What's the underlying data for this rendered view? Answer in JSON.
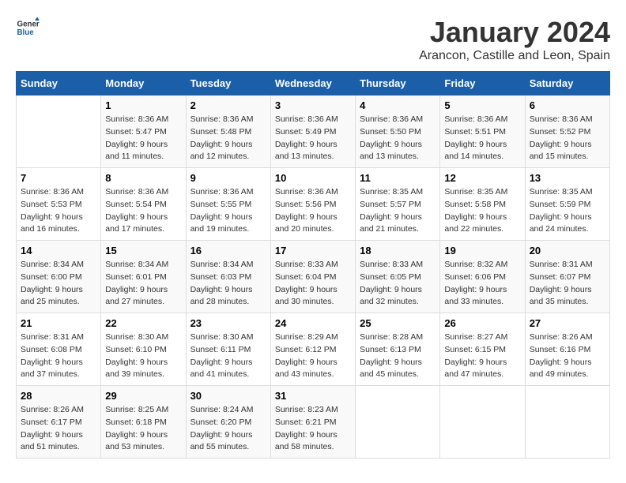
{
  "logo": {
    "text_general": "General",
    "text_blue": "Blue"
  },
  "title": "January 2024",
  "subtitle": "Arancon, Castille and Leon, Spain",
  "header": {
    "days": [
      "Sunday",
      "Monday",
      "Tuesday",
      "Wednesday",
      "Thursday",
      "Friday",
      "Saturday"
    ]
  },
  "weeks": [
    [
      {
        "num": "",
        "info": ""
      },
      {
        "num": "1",
        "info": "Sunrise: 8:36 AM\nSunset: 5:47 PM\nDaylight: 9 hours\nand 11 minutes."
      },
      {
        "num": "2",
        "info": "Sunrise: 8:36 AM\nSunset: 5:48 PM\nDaylight: 9 hours\nand 12 minutes."
      },
      {
        "num": "3",
        "info": "Sunrise: 8:36 AM\nSunset: 5:49 PM\nDaylight: 9 hours\nand 13 minutes."
      },
      {
        "num": "4",
        "info": "Sunrise: 8:36 AM\nSunset: 5:50 PM\nDaylight: 9 hours\nand 13 minutes."
      },
      {
        "num": "5",
        "info": "Sunrise: 8:36 AM\nSunset: 5:51 PM\nDaylight: 9 hours\nand 14 minutes."
      },
      {
        "num": "6",
        "info": "Sunrise: 8:36 AM\nSunset: 5:52 PM\nDaylight: 9 hours\nand 15 minutes."
      }
    ],
    [
      {
        "num": "7",
        "info": "Sunrise: 8:36 AM\nSunset: 5:53 PM\nDaylight: 9 hours\nand 16 minutes."
      },
      {
        "num": "8",
        "info": "Sunrise: 8:36 AM\nSunset: 5:54 PM\nDaylight: 9 hours\nand 17 minutes."
      },
      {
        "num": "9",
        "info": "Sunrise: 8:36 AM\nSunset: 5:55 PM\nDaylight: 9 hours\nand 19 minutes."
      },
      {
        "num": "10",
        "info": "Sunrise: 8:36 AM\nSunset: 5:56 PM\nDaylight: 9 hours\nand 20 minutes."
      },
      {
        "num": "11",
        "info": "Sunrise: 8:35 AM\nSunset: 5:57 PM\nDaylight: 9 hours\nand 21 minutes."
      },
      {
        "num": "12",
        "info": "Sunrise: 8:35 AM\nSunset: 5:58 PM\nDaylight: 9 hours\nand 22 minutes."
      },
      {
        "num": "13",
        "info": "Sunrise: 8:35 AM\nSunset: 5:59 PM\nDaylight: 9 hours\nand 24 minutes."
      }
    ],
    [
      {
        "num": "14",
        "info": "Sunrise: 8:34 AM\nSunset: 6:00 PM\nDaylight: 9 hours\nand 25 minutes."
      },
      {
        "num": "15",
        "info": "Sunrise: 8:34 AM\nSunset: 6:01 PM\nDaylight: 9 hours\nand 27 minutes."
      },
      {
        "num": "16",
        "info": "Sunrise: 8:34 AM\nSunset: 6:03 PM\nDaylight: 9 hours\nand 28 minutes."
      },
      {
        "num": "17",
        "info": "Sunrise: 8:33 AM\nSunset: 6:04 PM\nDaylight: 9 hours\nand 30 minutes."
      },
      {
        "num": "18",
        "info": "Sunrise: 8:33 AM\nSunset: 6:05 PM\nDaylight: 9 hours\nand 32 minutes."
      },
      {
        "num": "19",
        "info": "Sunrise: 8:32 AM\nSunset: 6:06 PM\nDaylight: 9 hours\nand 33 minutes."
      },
      {
        "num": "20",
        "info": "Sunrise: 8:31 AM\nSunset: 6:07 PM\nDaylight: 9 hours\nand 35 minutes."
      }
    ],
    [
      {
        "num": "21",
        "info": "Sunrise: 8:31 AM\nSunset: 6:08 PM\nDaylight: 9 hours\nand 37 minutes."
      },
      {
        "num": "22",
        "info": "Sunrise: 8:30 AM\nSunset: 6:10 PM\nDaylight: 9 hours\nand 39 minutes."
      },
      {
        "num": "23",
        "info": "Sunrise: 8:30 AM\nSunset: 6:11 PM\nDaylight: 9 hours\nand 41 minutes."
      },
      {
        "num": "24",
        "info": "Sunrise: 8:29 AM\nSunset: 6:12 PM\nDaylight: 9 hours\nand 43 minutes."
      },
      {
        "num": "25",
        "info": "Sunrise: 8:28 AM\nSunset: 6:13 PM\nDaylight: 9 hours\nand 45 minutes."
      },
      {
        "num": "26",
        "info": "Sunrise: 8:27 AM\nSunset: 6:15 PM\nDaylight: 9 hours\nand 47 minutes."
      },
      {
        "num": "27",
        "info": "Sunrise: 8:26 AM\nSunset: 6:16 PM\nDaylight: 9 hours\nand 49 minutes."
      }
    ],
    [
      {
        "num": "28",
        "info": "Sunrise: 8:26 AM\nSunset: 6:17 PM\nDaylight: 9 hours\nand 51 minutes."
      },
      {
        "num": "29",
        "info": "Sunrise: 8:25 AM\nSunset: 6:18 PM\nDaylight: 9 hours\nand 53 minutes."
      },
      {
        "num": "30",
        "info": "Sunrise: 8:24 AM\nSunset: 6:20 PM\nDaylight: 9 hours\nand 55 minutes."
      },
      {
        "num": "31",
        "info": "Sunrise: 8:23 AM\nSunset: 6:21 PM\nDaylight: 9 hours\nand 58 minutes."
      },
      {
        "num": "",
        "info": ""
      },
      {
        "num": "",
        "info": ""
      },
      {
        "num": "",
        "info": ""
      }
    ]
  ]
}
